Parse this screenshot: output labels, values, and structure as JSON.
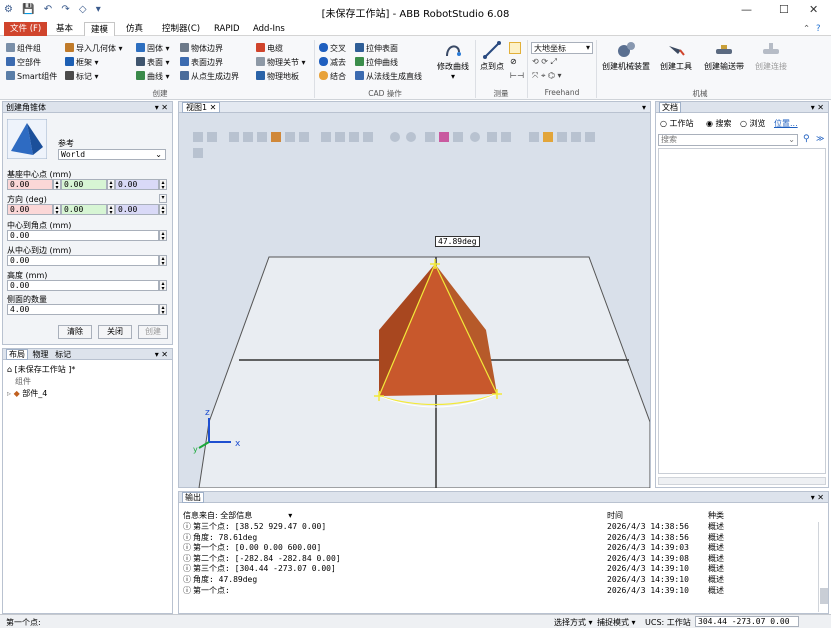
{
  "window": {
    "title": "[未保存工作站] - ABB RobotStudio 6.08",
    "minimize": "—",
    "maximize": "☐",
    "close": "✕"
  },
  "ribbon_tabs": [
    "文件 (F)",
    "基本",
    "建模",
    "仿真",
    "控制器(C)",
    "RAPID",
    "Add-Ins"
  ],
  "ribbon": {
    "create": {
      "group_label": "创建",
      "items": [
        "组件组",
        "空部件",
        "Smart组件",
        "导入几何体",
        "框架",
        "标记",
        "固体",
        "表面",
        "曲线",
        "物体边界",
        "表面边界",
        "从点生成边界",
        "电缆",
        "物理关节",
        "物理地板"
      ]
    },
    "cad": {
      "group_label": "CAD 操作",
      "items": [
        "交叉",
        "减去",
        "结合",
        "拉伸表面",
        "拉伸曲线",
        "从法线生成直线",
        "修改曲线"
      ]
    },
    "measure": {
      "group_label": "测量",
      "items": [
        "点到点"
      ]
    },
    "freehand": {
      "group_label": "Freehand",
      "frame": "大地坐标"
    },
    "mechanism": {
      "group_label": "机械",
      "items": [
        "创建机械装置",
        "创建工具",
        "创建输送带",
        "创建连接"
      ]
    }
  },
  "create_cone_panel": {
    "title": "创建角锥体",
    "ref_label": "参考",
    "ref_value": "World",
    "base_center_label": "基座中心点 (mm)",
    "base_center": [
      "0.00",
      "0.00",
      "0.00"
    ],
    "orientation_label": "方向 (deg)",
    "orientation": [
      "0.00",
      "0.00",
      "0.00"
    ],
    "center_to_corner_label": "中心到角点 (mm)",
    "center_to_corner": "0.00",
    "center_to_edge_label": "从中心到边 (mm)",
    "center_to_edge": "0.00",
    "height_label": "高度 (mm)",
    "height": "0.00",
    "sides_label": "侧面的数量",
    "sides": "4.00",
    "clear_btn": "清除",
    "close_btn": "关闭",
    "create_btn": "创建"
  },
  "layout_panel": {
    "tabs": [
      "布局",
      "物理",
      "标记"
    ],
    "station": "[未保存工作站 ]*",
    "group": "组件",
    "part": "部件_4"
  },
  "view": {
    "tab": "视图1",
    "angle_label": "47.89deg"
  },
  "docs_panel": {
    "title": "文档",
    "radio_station": "工作站",
    "radio_search": "搜索",
    "radio_browse": "浏览",
    "location_link": "位置...",
    "search_placeholder": "搜索"
  },
  "output": {
    "title": "输出",
    "source_label": "信息来自: 全部信息",
    "col_time": "时间",
    "col_type": "种类",
    "rows": [
      {
        "msg": "第三个点: [38.52 929.47 0.00]",
        "time": "2026/4/3 14:38:56",
        "type": "概述"
      },
      {
        "msg": "角度: 78.61deg",
        "time": "2026/4/3 14:38:56",
        "type": "概述"
      },
      {
        "msg": "第一个点: [0.00 0.00 600.00]",
        "time": "2026/4/3 14:39:03",
        "type": "概述"
      },
      {
        "msg": "第二个点: [-282.84 -282.84 0.00]",
        "time": "2026/4/3 14:39:08",
        "type": "概述"
      },
      {
        "msg": "第三个点: [304.44 -273.07 0.00]",
        "time": "2026/4/3 14:39:10",
        "type": "概述"
      },
      {
        "msg": "角度: 47.89deg",
        "time": "2026/4/3 14:39:10",
        "type": "概述"
      },
      {
        "msg": "第一个点:",
        "time": "2026/4/3 14:39:10",
        "type": "概述"
      }
    ]
  },
  "status": {
    "left": "第一个点:",
    "select_mode": "选择方式 ▾",
    "snap_mode": "捕捉模式 ▾",
    "ucs": "UCS: 工作站",
    "coords": "304.44  -273.07  0.00"
  },
  "colors": {
    "accent": "#d0442c",
    "pyramid": "#c8582c",
    "measure": "#f3e93a"
  }
}
